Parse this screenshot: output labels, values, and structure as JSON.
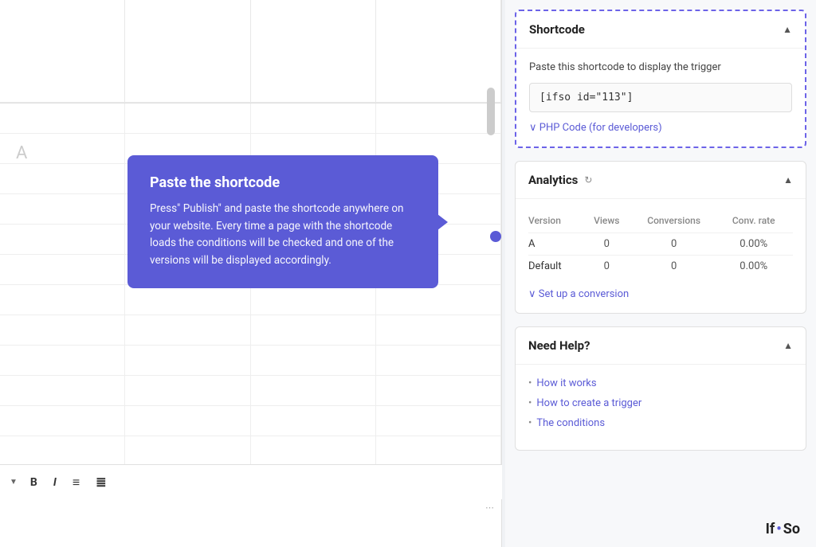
{
  "editor": {
    "col_a_label": "A",
    "toolbar_items": [
      "B",
      "I",
      "list-bullet",
      "list-ordered"
    ]
  },
  "tooltip": {
    "title": "Paste the shortcode",
    "text": "Press\" Publish\" and paste the shortcode anywhere on your website. Every time a page with the shortcode loads the conditions will be checked and one of the versions will be displayed accordingly."
  },
  "shortcode_panel": {
    "title": "Shortcode",
    "description": "Paste this shortcode to display the trigger",
    "shortcode_value": "[ifso id=\"113\"]",
    "php_link_label": "∨ PHP Code (for developers)"
  },
  "analytics_panel": {
    "title": "Analytics",
    "columns": [
      "Version",
      "Views",
      "Conversions",
      "Conv. rate"
    ],
    "rows": [
      {
        "version": "A",
        "views": "0",
        "conversions": "0",
        "conv_rate": "0.00%"
      },
      {
        "version": "Default",
        "views": "0",
        "conversions": "0",
        "conv_rate": "0.00%"
      }
    ],
    "conversion_link": "∨ Set up a conversion"
  },
  "help_panel": {
    "title": "Need Help?",
    "links": [
      "How it works",
      "How to create a trigger",
      "The conditions"
    ]
  },
  "logo": {
    "text_before": "If",
    "dot": "•",
    "text_after": "So"
  }
}
